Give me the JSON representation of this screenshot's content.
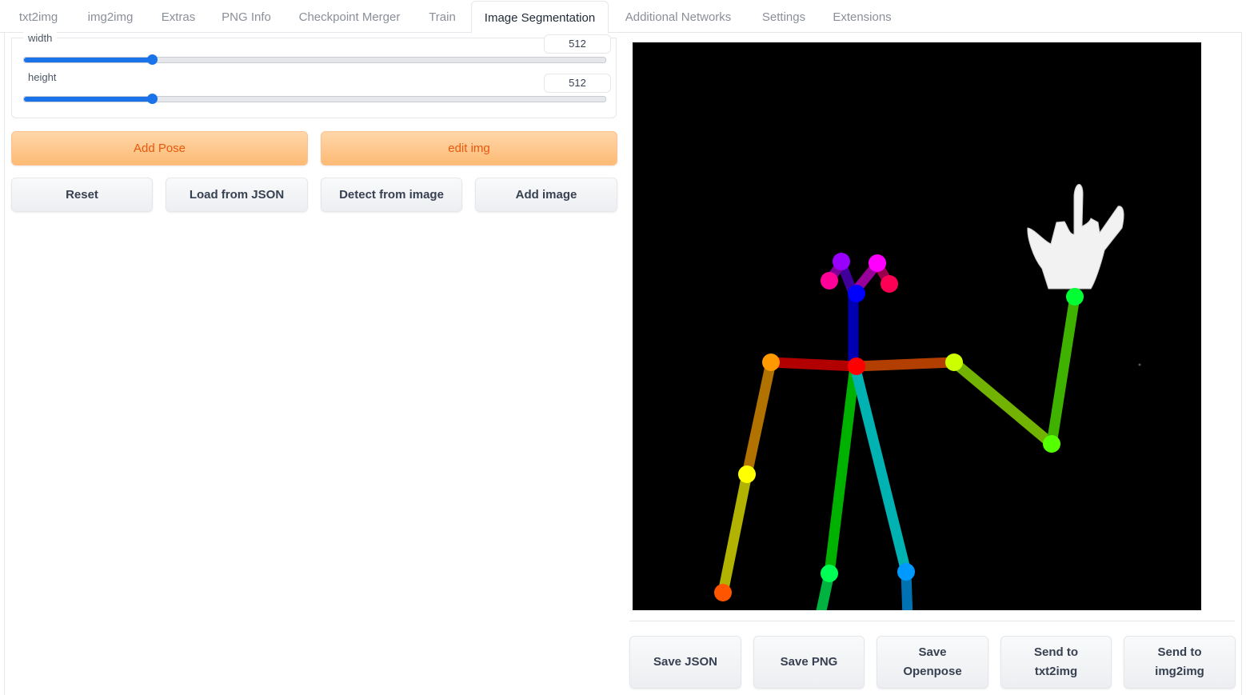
{
  "tabs": [
    {
      "label": "txt2img"
    },
    {
      "label": "img2img"
    },
    {
      "label": "Extras"
    },
    {
      "label": "PNG Info"
    },
    {
      "label": "Checkpoint Merger"
    },
    {
      "label": "Train"
    },
    {
      "label": "Image Segmentation"
    },
    {
      "label": "Additional Networks"
    },
    {
      "label": "Settings"
    },
    {
      "label": "Extensions"
    }
  ],
  "active_tab": "Image Segmentation",
  "sliders": {
    "width": {
      "label": "width",
      "value": "512",
      "fraction": 0.22
    },
    "height": {
      "label": "height",
      "value": "512",
      "fraction": 0.22
    }
  },
  "buttons": {
    "add_pose": "Add Pose",
    "edit_img": "edit img",
    "reset": "Reset",
    "load_json": "Load from JSON",
    "detect": "Detect from image",
    "add_image": "Add image"
  },
  "bottom_buttons": {
    "save_json": "Save JSON",
    "save_png": "Save PNG",
    "save_openpose_1": "Save",
    "save_openpose_2": "Openpose",
    "send_txt_1": "Send to",
    "send_txt_2": "txt2img",
    "send_img_1": "Send to",
    "send_img_2": "img2img"
  },
  "colors": {
    "accent": "#1a73e8",
    "primary_button": "#fdba74",
    "primary_text": "#ea580c",
    "canvas_bg": "#000000"
  }
}
